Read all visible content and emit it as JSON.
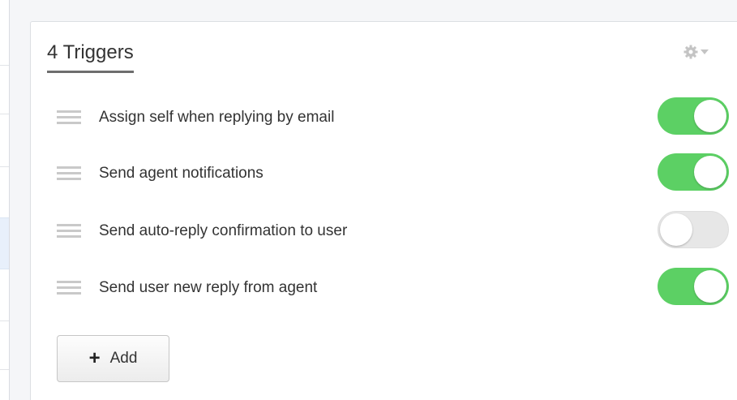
{
  "panel": {
    "title": "4 Triggers"
  },
  "settings_menu": {
    "icon": "gear-icon",
    "caret": "caret-down-icon"
  },
  "triggers": [
    {
      "label": "Assign self when replying by email",
      "enabled": true
    },
    {
      "label": "Send agent notifications",
      "enabled": true
    },
    {
      "label": "Send auto-reply confirmation to user",
      "enabled": false
    },
    {
      "label": "Send user new reply from agent",
      "enabled": true
    }
  ],
  "add_button": {
    "icon": "+",
    "label": "Add"
  },
  "colors": {
    "toggle_on": "#5cd064",
    "toggle_off": "#e7e7e7"
  }
}
